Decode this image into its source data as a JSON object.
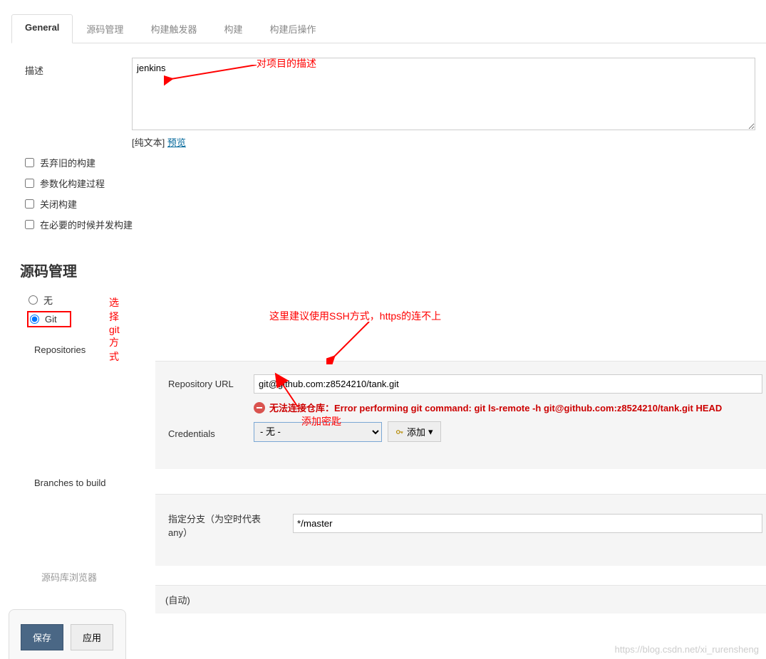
{
  "tabs": {
    "general": "General",
    "scm": "源码管理",
    "triggers": "构建触发器",
    "build": "构建",
    "postbuild": "构建后操作"
  },
  "general": {
    "desc_label": "描述",
    "desc_value": "jenkins",
    "plain_text": "[纯文本] ",
    "preview": "预览",
    "discard": "丢弃旧的构建",
    "parametrize": "参数化构建过程",
    "disable": "关闭构建",
    "concurrent": "在必要的时候并发构建"
  },
  "scm_section": {
    "title": "源码管理",
    "none": "无",
    "git": "Git",
    "repositories": "Repositories",
    "repo_url_label": "Repository URL",
    "repo_url_value": "git@github.com:z8524210/tank.git",
    "error": "无法连接仓库：Error performing git command: git ls-remote -h git@github.com:z8524210/tank.git HEAD",
    "credentials_label": "Credentials",
    "credentials_value": "- 无 -",
    "add_btn": "添加",
    "branches_label": "Branches to build",
    "branch_spec_label": "指定分支（为空时代表any）",
    "branch_spec_value": "*/master",
    "auto": "(自动)",
    "dim_label": "源码库浏览器"
  },
  "annotations": {
    "desc_note": "对项目的描述",
    "git_note": "选择git方式",
    "ssh_note": "这里建议使用SSH方式，https的连不上",
    "cred_note": "添加密匙"
  },
  "buttons": {
    "save": "保存",
    "apply": "应用"
  },
  "watermark": "https://blog.csdn.net/xi_rurensheng"
}
